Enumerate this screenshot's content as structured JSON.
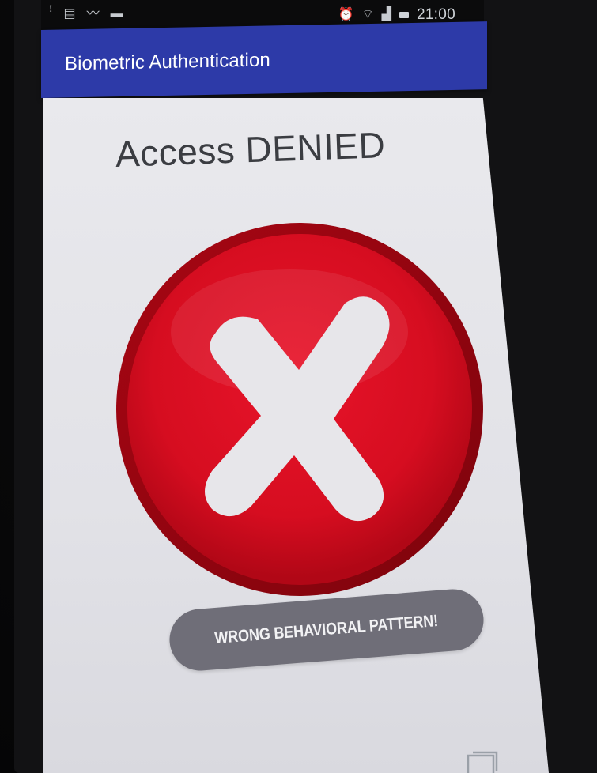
{
  "status_bar": {
    "left_icons": [
      "notification-icon",
      "message-icon",
      "activity-icon",
      "image-icon"
    ],
    "right_icons": [
      "alarm-icon",
      "wifi-icon",
      "signal-icon",
      "battery-icon"
    ],
    "time": "21:00"
  },
  "app_bar": {
    "title": "Biometric Authentication",
    "color": "#2d3aa8"
  },
  "main": {
    "headline": "Access DENIED",
    "symbol": "red-x-icon",
    "symbol_color": "#d8101f"
  },
  "toast": {
    "message": "WRONG BEHAVIORAL PATTERN!",
    "color": "#6f6e78"
  },
  "nav": {
    "icons": [
      "recents-icon"
    ]
  }
}
